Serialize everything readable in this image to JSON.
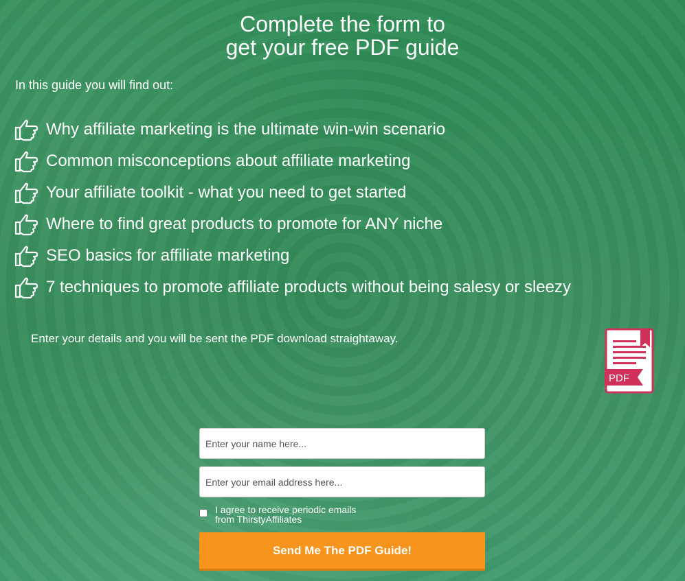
{
  "header": {
    "title_line1": "Complete the form to",
    "title_line2": "get your free PDF guide"
  },
  "intro": "In this guide you will find out:",
  "benefits": [
    "Why affiliate marketing is the ultimate win-win scenario",
    "Common misconceptions about affiliate marketing",
    "Your affiliate toolkit - what you need to get started",
    "Where to find great products to promote for ANY niche",
    "SEO basics for affiliate marketing",
    "7 techniques to promote affiliate products without being salesy or sleezy"
  ],
  "details_text": "Enter your details and you will be sent the PDF download straightaway.",
  "pdf_badge": {
    "icon": "pdf-file-icon",
    "label": "PDF",
    "color": "#d0315a"
  },
  "form": {
    "name_placeholder": "Enter your name here...",
    "email_placeholder": "Enter your email address here...",
    "consent_line1": "I agree to receive periodic emails",
    "consent_line2": "from ThirstyAffiliates",
    "consent_checked": false,
    "submit_label": "Send Me The PDF Guide!"
  },
  "colors": {
    "background": "#338a58",
    "button": "#f7941d",
    "text": "#ffffff"
  },
  "icons": {
    "bullet": "thumbs-pointing-hand-icon"
  }
}
